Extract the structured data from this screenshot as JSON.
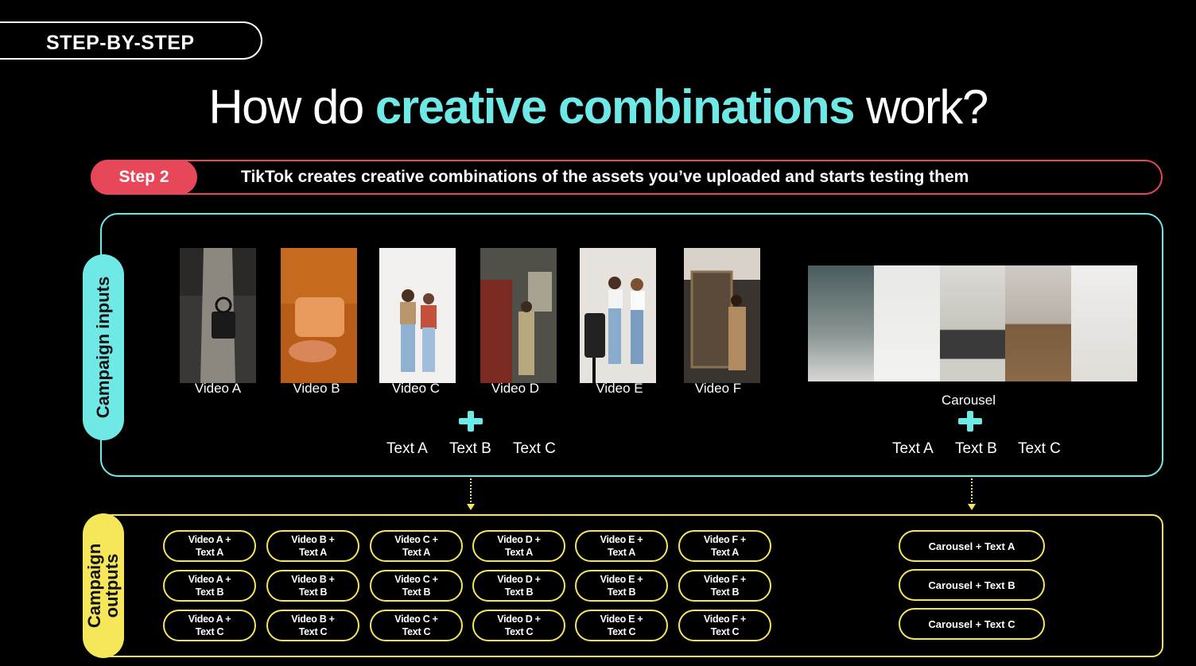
{
  "header": {
    "tag": "STEP-BY-STEP"
  },
  "title": {
    "part1": "How do ",
    "highlight": "creative combinations",
    "part2": " work?"
  },
  "step": {
    "label": "Step 2",
    "text": "TikTok creates creative combinations of the assets you’ve uploaded and starts testing them"
  },
  "inputs": {
    "label": "Campaign inputs",
    "videos": [
      "Video A",
      "Video B",
      "Video C",
      "Video D",
      "Video E",
      "Video F"
    ],
    "carousel_label": "Carousel",
    "texts": [
      "Text A",
      "Text B",
      "Text C"
    ]
  },
  "outputs": {
    "label": "Campaign outputs",
    "video_combos": [
      [
        [
          "Video A +",
          "Text A"
        ],
        [
          "Video A +",
          "Text B"
        ],
        [
          "Video A +",
          "Text C"
        ]
      ],
      [
        [
          "Video B +",
          "Text A"
        ],
        [
          "Video B +",
          "Text B"
        ],
        [
          "Video B +",
          "Text C"
        ]
      ],
      [
        [
          "Video C +",
          "Text A"
        ],
        [
          "Video C +",
          "Text B"
        ],
        [
          "Video C +",
          "Text C"
        ]
      ],
      [
        [
          "Video D +",
          "Text A"
        ],
        [
          "Video D +",
          "Text B"
        ],
        [
          "Video D +",
          "Text C"
        ]
      ],
      [
        [
          "Video E +",
          "Text A"
        ],
        [
          "Video E +",
          "Text B"
        ],
        [
          "Video E +",
          "Text C"
        ]
      ],
      [
        [
          "Video F +",
          "Text A"
        ],
        [
          "Video F +",
          "Text B"
        ],
        [
          "Video F +",
          "Text C"
        ]
      ]
    ],
    "carousel_combos": [
      "Carousel + Text A",
      "Carousel + Text B",
      "Carousel + Text C"
    ]
  },
  "colors": {
    "accent_cyan": "#6ee9e6",
    "accent_red": "#e8475a",
    "accent_yellow": "#f6e65a",
    "background": "#000000"
  }
}
